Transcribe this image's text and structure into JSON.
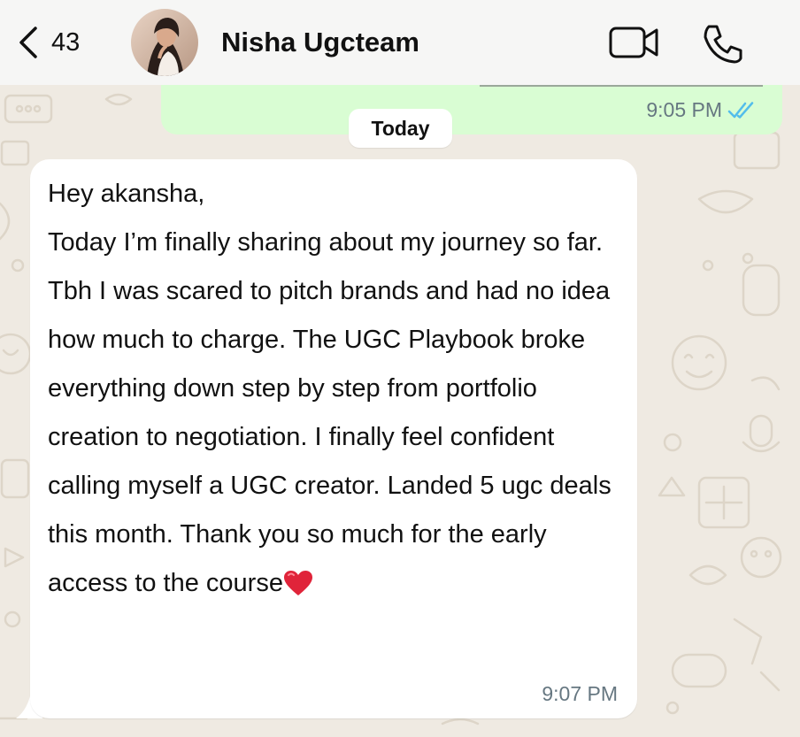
{
  "header": {
    "back_count": "43",
    "contact_name": "Nisha Ugcteam"
  },
  "outgoing_message": {
    "time": "9:05 PM",
    "status": "read"
  },
  "date_separator": "Today",
  "incoming_message": {
    "text": "Hey akansha,\nToday I’m finally sharing about my journey so far. Tbh I was scared to pitch brands and had no idea how much to charge. The UGC Playbook broke everything down step by step from portfolio creation to negotiation. I finally feel confident calling myself a UGC creator. Landed 5 ugc deals this month. Thank you so much for the early access to the course",
    "emoji": "red-heart",
    "time": "9:07 PM"
  },
  "colors": {
    "wallpaper": "#efeae2",
    "outgoing_bubble": "#d9fdd3",
    "incoming_bubble": "#ffffff",
    "read_ticks": "#53bdeb",
    "timestamp": "#667781"
  }
}
